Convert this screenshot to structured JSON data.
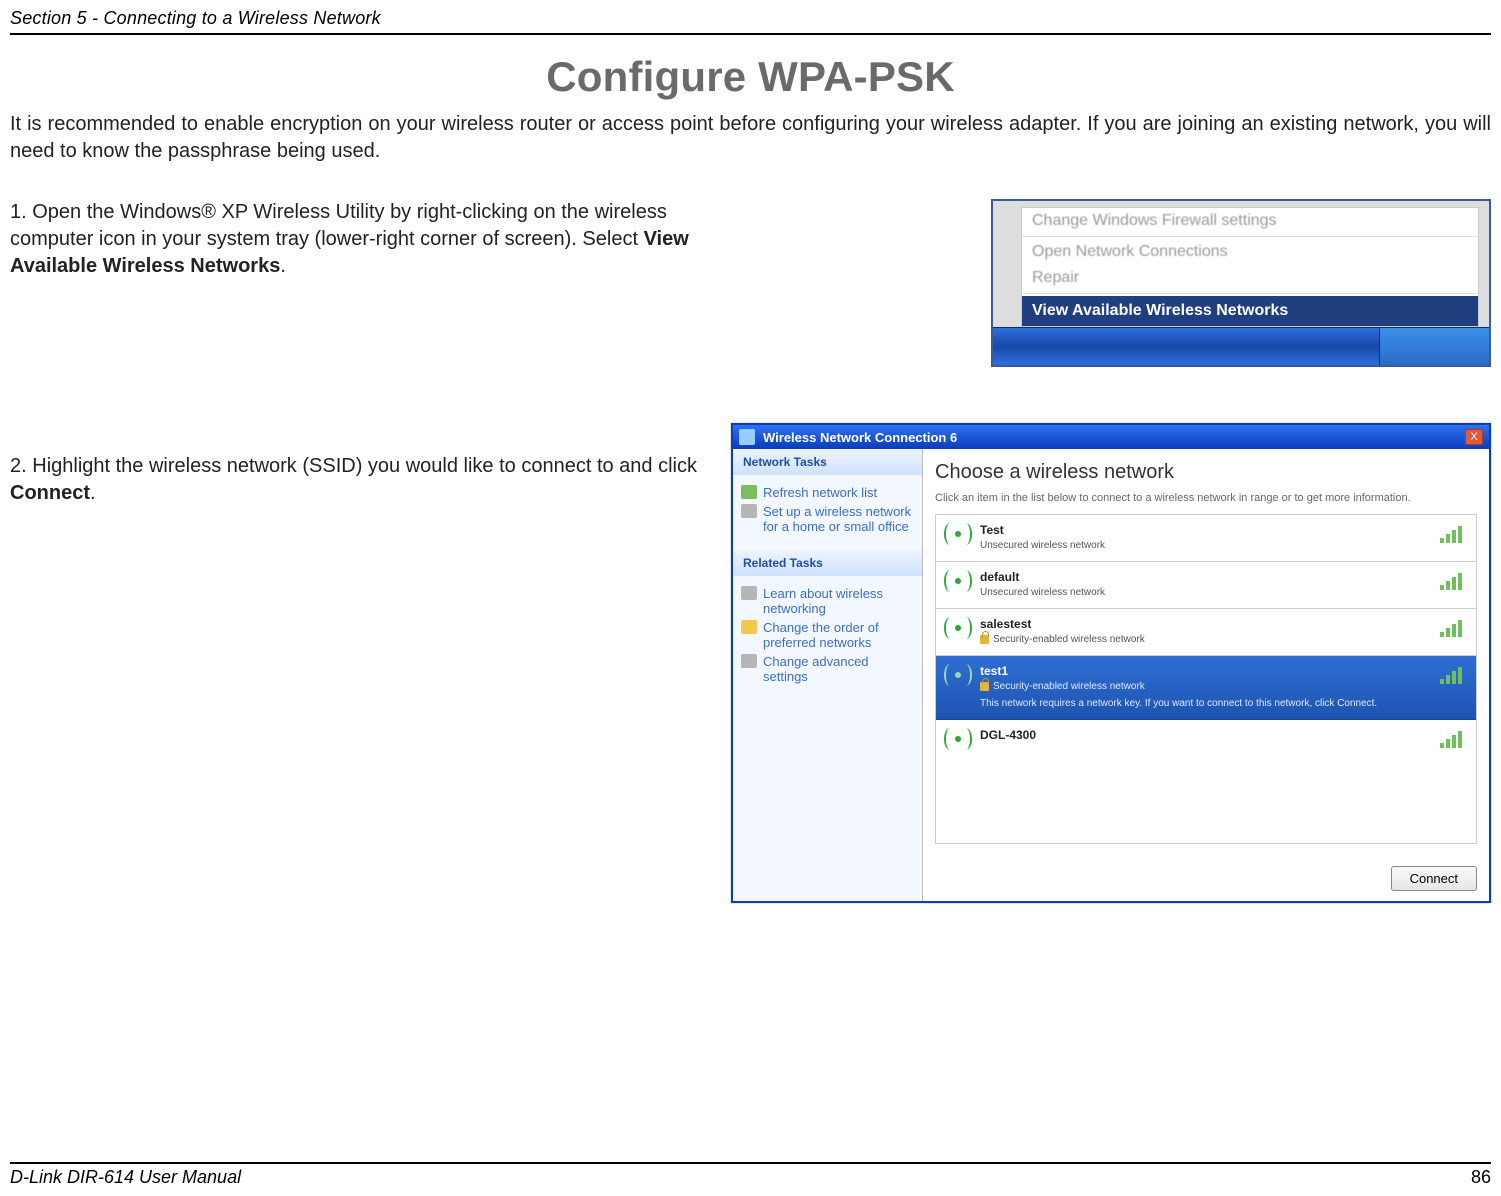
{
  "section_header": "Section 5 - Connecting to a Wireless Network",
  "page_title": "Configure WPA-PSK",
  "intro": "It is recommended to enable encryption on your wireless router or access point before configuring your wireless adapter. If you are joining an existing network, you will need to know the passphrase being used.",
  "steps": [
    {
      "prefix": "1.  ",
      "text_before_bold": "Open the Windows® XP Wireless Utility by right-clicking on the wireless computer icon in your system tray (lower-right corner of screen). Select ",
      "bold": "View Available Wireless Networks",
      "text_after_bold": "."
    },
    {
      "prefix": "2.  ",
      "text_before_bold": "Highlight the wireless network (SSID) you would like to connect to and click ",
      "bold": "Connect",
      "text_after_bold": "."
    }
  ],
  "shot1_menu": {
    "items": [
      "Change Windows Firewall settings",
      "Open Network Connections",
      "Repair"
    ],
    "active": "View Available Wireless Networks"
  },
  "shot2": {
    "titlebar": "Wireless Network Connection 6",
    "close_glyph": "X",
    "side": {
      "sec1_header": "Network Tasks",
      "link_refresh": "Refresh network list",
      "link_setup": "Set up a wireless network for a home or small office",
      "sec2_header": "Related Tasks",
      "link_learn": "Learn about wireless networking",
      "link_order": "Change the order of preferred networks",
      "link_advanced": "Change advanced settings"
    },
    "main_title": "Choose a wireless network",
    "main_sub": "Click an item in the list below to connect to a wireless network in range or to get more information.",
    "networks": [
      {
        "name": "Test",
        "desc": "Unsecured wireless network",
        "selected": false,
        "secured": false
      },
      {
        "name": "default",
        "desc": "Unsecured wireless network",
        "selected": false,
        "secured": false
      },
      {
        "name": "salestest",
        "desc": "Security-enabled wireless network",
        "selected": false,
        "secured": true
      },
      {
        "name": "test1",
        "desc": "Security-enabled wireless network",
        "extra": "This network requires a network key. If you want to connect to this network, click Connect.",
        "selected": true,
        "secured": true
      },
      {
        "name": "DGL-4300",
        "desc": "",
        "selected": false,
        "secured": false
      }
    ],
    "connect_label": "Connect"
  },
  "footer_left": "D-Link DIR-614 User Manual",
  "footer_right": "86"
}
